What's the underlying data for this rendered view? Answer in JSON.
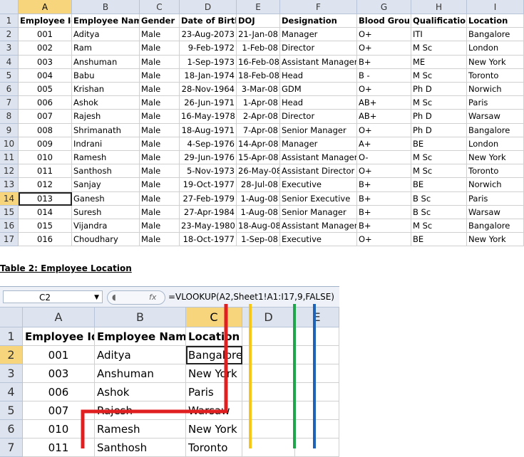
{
  "sheet1": {
    "columns": [
      "A",
      "B",
      "C",
      "D",
      "E",
      "F",
      "G",
      "H",
      "I"
    ],
    "selected_row": "14",
    "headers": [
      "Employee Id",
      "Employee Name",
      "Gender",
      "Date of Birth",
      "DOJ",
      "Designation",
      "Blood Group",
      "Qualification",
      "Location"
    ],
    "rows": [
      [
        "001",
        "Aditya",
        "Male",
        "23-Aug-2073",
        "21-Jan-08",
        "Manager",
        "O+",
        "ITI",
        "Bangalore"
      ],
      [
        "002",
        "Ram",
        "Male",
        "9-Feb-1972",
        "1-Feb-08",
        "Director",
        "O+",
        "M Sc",
        "London"
      ],
      [
        "003",
        "Anshuman",
        "Male",
        "1-Sep-1973",
        "16-Feb-08",
        "Assistant Manager",
        "B+",
        "ME",
        "New York"
      ],
      [
        "004",
        "Babu",
        "Male",
        "18-Jan-1974",
        "18-Feb-08",
        "Head",
        "B -",
        "M Sc",
        "Toronto"
      ],
      [
        "005",
        "Krishan",
        "Male",
        "28-Nov-1964",
        "3-Mar-08",
        "GDM",
        "O+",
        "Ph D",
        "Norwich"
      ],
      [
        "006",
        "Ashok",
        "Male",
        "26-Jun-1971",
        "1-Apr-08",
        "Head",
        "AB+",
        "M Sc",
        "Paris"
      ],
      [
        "007",
        "Rajesh",
        "Male",
        "16-May-1978",
        "2-Apr-08",
        "Director",
        "AB+",
        "Ph D",
        "Warsaw"
      ],
      [
        "008",
        "Shrimanath",
        "Male",
        "18-Aug-1971",
        "7-Apr-08",
        "Senior Manager",
        "O+",
        "Ph D",
        "Bangalore"
      ],
      [
        "009",
        "Indrani",
        "Male",
        "4-Sep-1976",
        "14-Apr-08",
        "Manager",
        "A+",
        "BE",
        "London"
      ],
      [
        "010",
        "Ramesh",
        "Male",
        "29-Jun-1976",
        "15-Apr-08",
        "Assistant Manager",
        "O-",
        "M Sc",
        "New York"
      ],
      [
        "011",
        "Santhosh",
        "Male",
        "5-Nov-1973",
        "26-May-08",
        "Assistant Director",
        "O+",
        "M Sc",
        "Toronto"
      ],
      [
        "012",
        "Sanjay",
        "Male",
        "19-Oct-1977",
        "28-Jul-08",
        "Executive",
        "B+",
        "BE",
        "Norwich"
      ],
      [
        "013",
        "Ganesh",
        "Male",
        "27-Feb-1979",
        "1-Aug-08",
        "Senior Executive",
        "B+",
        "B Sc",
        "Paris"
      ],
      [
        "014",
        "Suresh",
        "Male",
        "27-Apr-1984",
        "1-Aug-08",
        "Senior Manager",
        "B+",
        "B Sc",
        "Warsaw"
      ],
      [
        "015",
        "Vijandra",
        "Male",
        "23-May-1980",
        "18-Aug-08",
        "Assistant Manager",
        "B+",
        "M Sc",
        "Bangalore"
      ],
      [
        "016",
        "Choudhary",
        "Male",
        "18-Oct-1977",
        "1-Sep-08",
        "Executive",
        "O+",
        "BE",
        "New York"
      ]
    ]
  },
  "caption": "Table 2: Employee Location",
  "sheet2": {
    "name_box": "C2",
    "fx_label": "fx",
    "formula": "=VLOOKUP(A2,Sheet1!A1:I17,9,FALSE)",
    "columns": [
      "A",
      "B",
      "C",
      "D",
      "E"
    ],
    "headers": [
      "Employee Id",
      "Employee Name",
      "Location"
    ],
    "rows": [
      [
        "001",
        "Aditya",
        "Bangalore"
      ],
      [
        "003",
        "Anshuman",
        "New York"
      ],
      [
        "006",
        "Ashok",
        "Paris"
      ],
      [
        "007",
        "Rajesh",
        "Warsaw"
      ],
      [
        "010",
        "Ramesh",
        "New York"
      ],
      [
        "011",
        "Santhosh",
        "Toronto"
      ]
    ],
    "annotation_colors": {
      "red": "#e02020",
      "yellow": "#f5c518",
      "green": "#1fa64a",
      "blue": "#1e63b8"
    }
  }
}
